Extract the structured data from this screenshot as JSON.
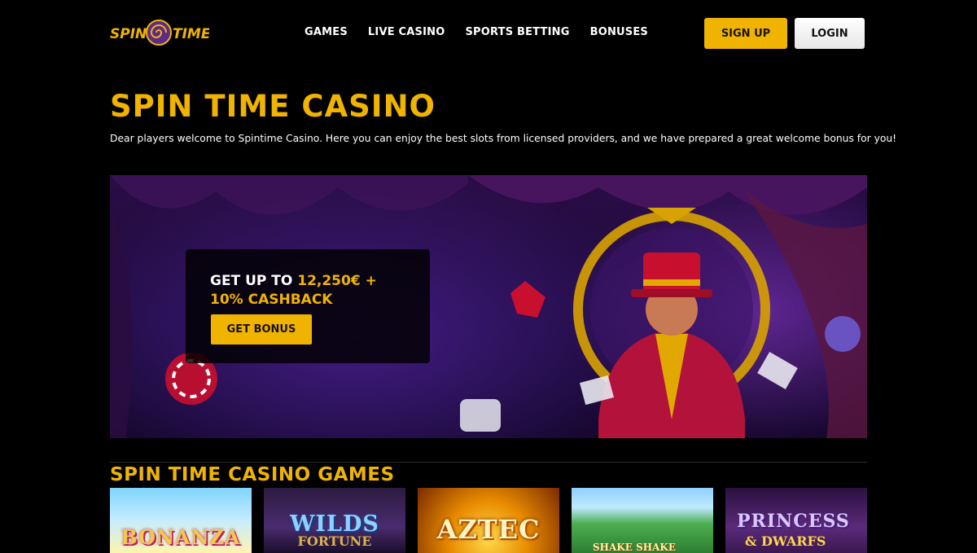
{
  "header": {
    "logo_text": "SPIN TIME",
    "nav": [
      "GAMES",
      "LIVE CASINO",
      "SPORTS BETTING",
      "BONUSES"
    ],
    "signup_label": "SIGN UP",
    "login_label": "LOGIN"
  },
  "intro": {
    "title": "SPIN TIME CASINO",
    "text": "Dear players welcome to Spintime Casino. Here you can enjoy the best slots from licensed providers, and we have prepared a great welcome bonus for you!"
  },
  "banner": {
    "promo_prefix": "GET UP TO ",
    "promo_amount": "12,250€ +",
    "promo_line2": "10% CASHBACK",
    "button_label": "GET BONUS"
  },
  "games": {
    "heading": "SPIN TIME CASINO GAMES",
    "items": [
      {
        "title": "BONANZA",
        "subtitle": ""
      },
      {
        "title": "WILDS",
        "subtitle": "FORTUNE"
      },
      {
        "title": "AZTEC",
        "subtitle": ""
      },
      {
        "title": "SHAKE SHAKE",
        "subtitle": ""
      },
      {
        "title": "PRINCESS",
        "subtitle": "& DWARFS"
      }
    ]
  },
  "colors": {
    "accent": "#f0b400",
    "background": "#000000",
    "banner_purple": "#2a0d46"
  }
}
